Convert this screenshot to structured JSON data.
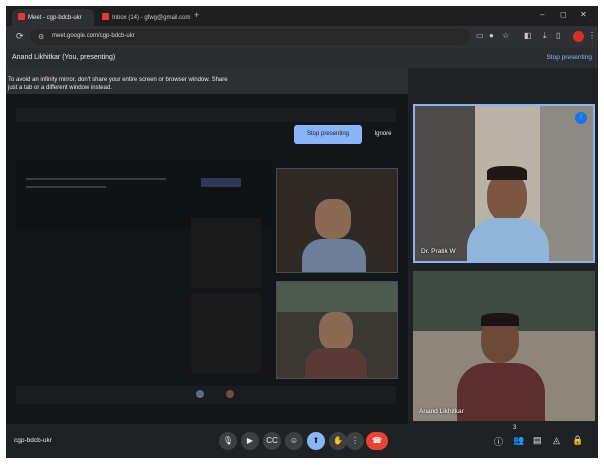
{
  "browser": {
    "tabs": [
      {
        "label": "Meet - cgp-bdcb-ukr",
        "icon": "meet-icon",
        "active": true
      },
      {
        "label": "Inbox (14) - gfwg@gmail.com",
        "icon": "gmail-icon",
        "active": false
      }
    ],
    "new_tab": "+",
    "window_controls": [
      "–",
      "◻",
      "✕"
    ],
    "url": "meet.google.com/cgp-bdcb-ukr"
  },
  "meet": {
    "presenter_banner": "Anand Likhitkar (You, presenting)",
    "stop_presenting_link": "Stop presenting",
    "warning_line1": "To avoid an infinity mirror, don't share your entire screen or browser window. Share",
    "warning_line2": "just a tab or a different window instead.",
    "stop_presenting_button": "Stop presenting",
    "ignore_button": "Ignore",
    "participants": [
      {
        "name": "Dr. Pratik W",
        "speaking": true
      },
      {
        "name": "Anand Likhitkar",
        "speaking": false
      }
    ],
    "meeting_code": "cgp-bdcb-ukr",
    "people_count": "3",
    "controls": [
      "mic-icon",
      "camera-icon",
      "captions-icon",
      "emoji-icon",
      "present-icon",
      "hand-icon",
      "more-icon",
      "end-call-icon"
    ],
    "side_controls": [
      "info-icon",
      "people-icon",
      "chat-icon",
      "activities-icon",
      "lock-icon"
    ],
    "accent_color": "#8ab4f8",
    "end_call_color": "#ea4335"
  }
}
